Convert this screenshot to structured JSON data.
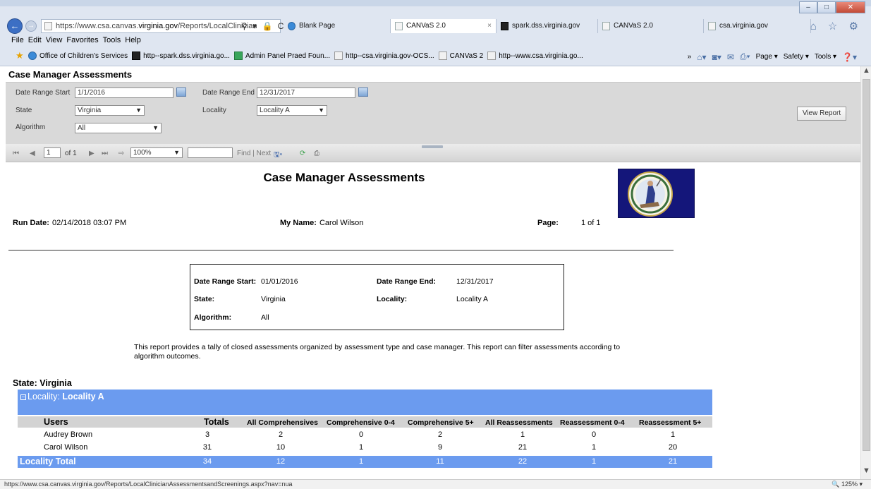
{
  "browser": {
    "url_prefix": "https://www.csa.canvas.",
    "url_host": "virginia.gov",
    "url_rest": "/Reports/LocalClinician",
    "address_icons": "⚲ ▾ 🔒 C",
    "tabs": [
      {
        "label": "Blank Page",
        "icon": "ie-icon"
      },
      {
        "label": "CANVaS 2.0",
        "icon": "page-icon"
      },
      {
        "label": "spark.dss.virginia.gov",
        "icon": "s-icon"
      },
      {
        "label": "CANVaS 2.0",
        "icon": "page-icon"
      },
      {
        "label": "csa.virginia.gov",
        "icon": "page-icon"
      }
    ],
    "tab_close": "×",
    "right_icons": "⌂ ☆ ⚙",
    "menu": [
      "File",
      "Edit",
      "View",
      "Favorites",
      "Tools",
      "Help"
    ],
    "favorites": [
      "Office of Children's Services",
      "http--spark.dss.virginia.go...",
      "Admin Panel  Praed Foun...",
      "http--csa.virginia.gov-OCS...",
      "CANVaS 2",
      "http--www.csa.virginia.go..."
    ],
    "chevron": "»",
    "command_bar": [
      "Page ▾",
      "Safety ▾",
      "Tools ▾"
    ],
    "status_url": "https://www.csa.canvas.virginia.gov/Reports/LocalClinicianAssessmentsandScreenings.aspx?nav=nua",
    "zoom": "🔍 125%  ▾"
  },
  "page_header": "Case Manager Assessments",
  "params": {
    "date_start_label": "Date Range Start",
    "date_start_value": "1/1/2016",
    "date_end_label": "Date Range End",
    "date_end_value": "12/31/2017",
    "state_label": "State",
    "state_value": "Virginia",
    "locality_label": "Locality",
    "locality_value": "Locality A",
    "algorithm_label": "Algorithm",
    "algorithm_value": "All",
    "view_report": "View Report"
  },
  "toolbar": {
    "first": "⏮",
    "prev": "◀",
    "page_value": "1",
    "of_pages": "of 1",
    "next": "▶",
    "last": "⏭",
    "refresh_nav": "⇨",
    "zoom_value": "100%",
    "find_next": "Find | Next",
    "export": "🖫▾",
    "refresh": "⟳",
    "print": "⎙"
  },
  "report": {
    "title": "Case Manager Assessments",
    "run_date_label": "Run Date:",
    "run_date_value": "02/14/2018 03:07 PM",
    "my_name_label": "My Name:",
    "my_name_value": "Carol Wilson",
    "page_label": "Page:",
    "page_value": "1 of 1",
    "box": {
      "start_label": "Date Range Start:",
      "start_value": "01/01/2016",
      "end_label": "Date Range End:",
      "end_value": "12/31/2017",
      "state_label": "State:",
      "state_value": "Virginia",
      "locality_label": "Locality:",
      "locality_value": "Locality A",
      "algorithm_label": "Algorithm:",
      "algorithm_value": "All"
    },
    "description": "This report provides a tally of closed assessments organized by assessment type and case manager. This report can filter assessments according to algorithm outcomes.",
    "state_header": "State: Virginia",
    "locality_prefix": "Locality:",
    "locality_name": "Locality A",
    "expander": "−",
    "columns": [
      "Users",
      "Totals",
      "All Comprehensives",
      "Comprehensive 0-4",
      "Comprehensive 5+",
      "All Reassessments",
      "Reassessment 0-4",
      "Reassessment 5+"
    ],
    "rows": [
      {
        "name": "Audrey Brown",
        "values": [
          "3",
          "2",
          "0",
          "2",
          "1",
          "0",
          "1"
        ]
      },
      {
        "name": "Carol Wilson",
        "values": [
          "31",
          "10",
          "1",
          "9",
          "21",
          "1",
          "20"
        ]
      }
    ],
    "total_label": "Locality Total",
    "totals": [
      "34",
      "12",
      "1",
      "11",
      "22",
      "1",
      "21"
    ]
  },
  "colors": {
    "band_blue": "#6b9bef",
    "param_gray": "#d9d9d9",
    "seal_navy": "#14167a"
  }
}
